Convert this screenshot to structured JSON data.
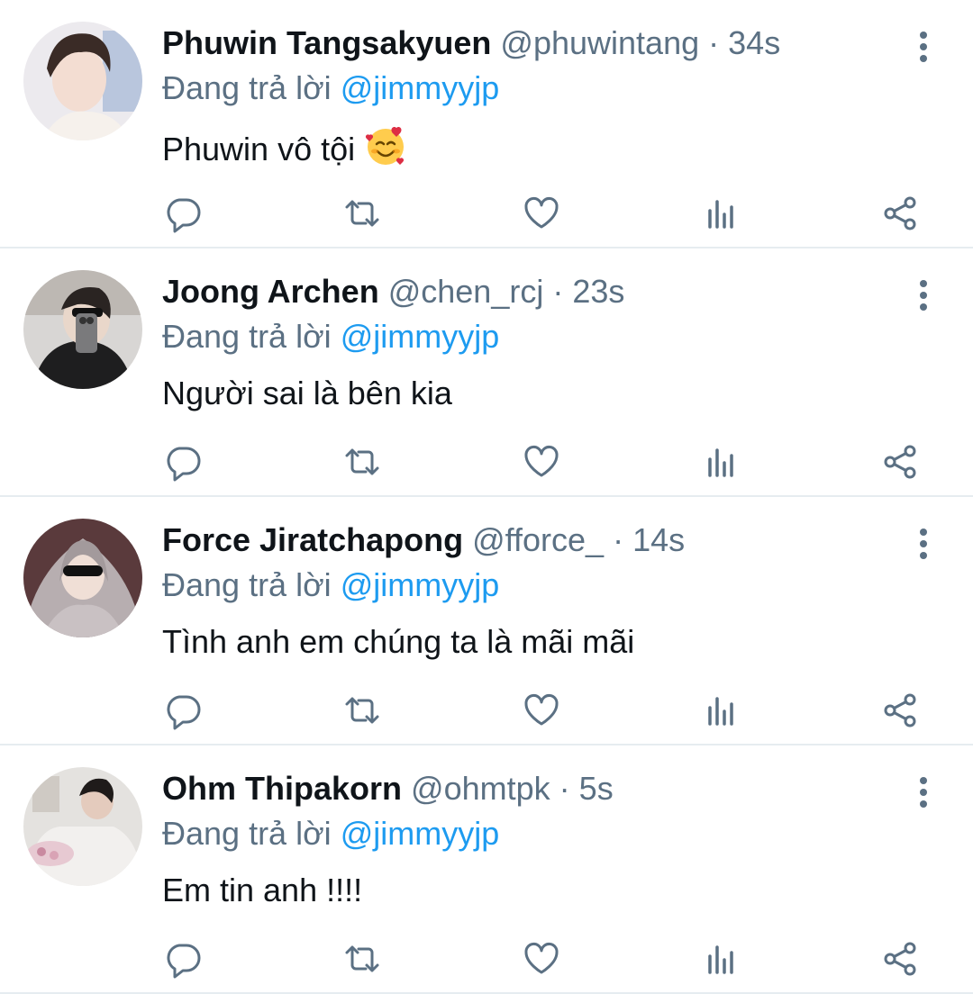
{
  "tweets": [
    {
      "name": "Phuwin Tangsakyuen",
      "handle": "@phuwintang",
      "time": "34s",
      "replying_prefix": "Đang trả lời",
      "replying_to": "@jimmyyjp",
      "text": "Phuwin vô tội",
      "emoji": "smiling-face-with-hearts"
    },
    {
      "name": "Joong Archen",
      "handle": "@chen_rcj",
      "time": "23s",
      "replying_prefix": "Đang trả lời",
      "replying_to": "@jimmyyjp",
      "text": "Người sai là bên kia"
    },
    {
      "name": "Force Jiratchapong",
      "handle": "@fforce_",
      "time": "14s",
      "replying_prefix": "Đang trả lời",
      "replying_to": "@jimmyyjp",
      "text": "Tình anh em chúng ta là mãi mãi"
    },
    {
      "name": "Ohm Thipakorn",
      "handle": "@ohmtpk",
      "time": "5s",
      "replying_prefix": "Đang trả lời",
      "replying_to": "@jimmyyjp",
      "text": "Em tin anh !!!!"
    }
  ],
  "separator": "·",
  "actions": [
    "reply-icon",
    "retweet-icon",
    "like-icon",
    "analytics-icon",
    "share-icon"
  ],
  "colors": {
    "text": "#0f1419",
    "secondary": "#5b7083",
    "link": "#1d9bf0",
    "divider": "#e6ecf0"
  }
}
